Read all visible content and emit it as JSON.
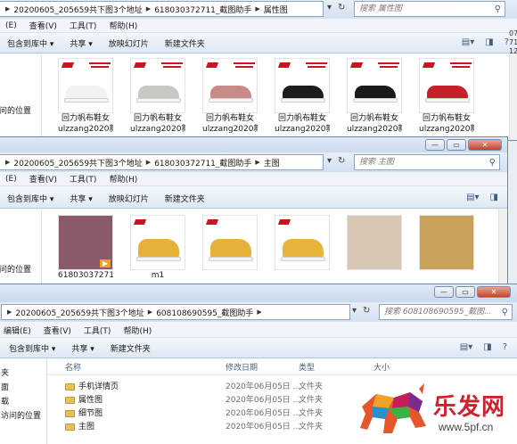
{
  "win1": {
    "address": [
      "20200605_205659共下图3个地址",
      "618030372711_截图助手",
      "属性图"
    ],
    "search_placeholder": "搜索 属性图",
    "menu": [
      "(E)",
      "查看(V)",
      "工具(T)",
      "帮助(H)"
    ],
    "toolbar": [
      "包含到库中 ▾",
      "共享 ▾",
      "放映幻灯片",
      "新建文件夹"
    ],
    "nav_items": [
      "问的位置"
    ],
    "side_text": [
      "07",
      "71",
      "12"
    ],
    "thumbs": [
      {
        "line1": "回力帆布鞋女",
        "line2": "ulzzang2020新",
        "shoe_color": "#f2f2ef"
      },
      {
        "line1": "回力帆布鞋女",
        "line2": "ulzzang2020新",
        "shoe_color": "#c9c9c4"
      },
      {
        "line1": "回力帆布鞋女",
        "line2": "ulzzang2020新",
        "shoe_color": "#c98a8a"
      },
      {
        "line1": "回力帆布鞋女",
        "line2": "ulzzang2020新",
        "shoe_color": "#1d1d1d"
      },
      {
        "line1": "回力帆布鞋女",
        "line2": "ulzzang2020新",
        "shoe_color": "#1a1a1a"
      },
      {
        "line1": "回力帆布鞋女",
        "line2": "ulzzang2020新",
        "shoe_color": "#c8202a"
      }
    ]
  },
  "win2": {
    "address": [
      "20200605_205659共下图3个地址",
      "618030372711_截图助手",
      "主图"
    ],
    "search_placeholder": "搜索 主图",
    "menu": [
      "(E)",
      "查看(V)",
      "工具(T)",
      "帮助(H)"
    ],
    "toolbar": [
      "包含到库中 ▾",
      "共享 ▾",
      "放映幻灯片",
      "新建文件夹"
    ],
    "nav_items": [
      "问的位置"
    ],
    "thumbs": [
      {
        "caption": "618030372711_",
        "kind": "video",
        "bg": "#8a5a6a"
      },
      {
        "caption": "m1",
        "kind": "shoe",
        "bg": "#e8b23a"
      },
      {
        "caption": "",
        "kind": "shoe",
        "bg": "#e8b23a"
      },
      {
        "caption": "",
        "kind": "shoe",
        "bg": "#e9b43b"
      },
      {
        "caption": "",
        "kind": "photo",
        "bg": "#d9c7b5"
      },
      {
        "caption": "",
        "kind": "photo",
        "bg": "#caa15a"
      },
      {
        "caption": "",
        "kind": "photo",
        "bg": "#9aa0a6"
      }
    ]
  },
  "win3": {
    "address": [
      "20200605_205659共下图3个地址",
      "608108690595_截图助手"
    ],
    "search_placeholder": "搜索 608108690595_截图...",
    "menu": [
      "编辑(E)",
      "查看(V)",
      "工具(T)",
      "帮助(H)"
    ],
    "toolbar": [
      "包含到库中 ▾",
      "共享 ▾",
      "新建文件夹"
    ],
    "nav_items": [
      "夹",
      "面",
      "载",
      "访问的位置"
    ],
    "columns": {
      "name": "名称",
      "date": "修改日期",
      "type": "类型",
      "size": "大小"
    },
    "rows": [
      {
        "name": "手机详情页",
        "date": "2020年06月05日 ...",
        "type": "文件夹"
      },
      {
        "name": "属性图",
        "date": "2020年06月05日 ...",
        "type": "文件夹"
      },
      {
        "name": "细节图",
        "date": "2020年06月05日 ...",
        "type": "文件夹"
      },
      {
        "name": "主图",
        "date": "2020年06月05日 ...",
        "type": "文件夹"
      }
    ]
  },
  "watermark": {
    "brand": "乐发网",
    "url": "www.5pf.cn"
  },
  "colors": {
    "accent": "#cde4fb",
    "window_frame": "#6f87a8",
    "folder": "#e8c158",
    "brand_red": "#d21f2b"
  },
  "icons": [
    "refresh-icon",
    "search-icon",
    "view-options-icon",
    "preview-pane-icon",
    "help-icon",
    "folder-icon",
    "minimize-icon",
    "maximize-icon",
    "close-icon",
    "play-icon"
  ]
}
